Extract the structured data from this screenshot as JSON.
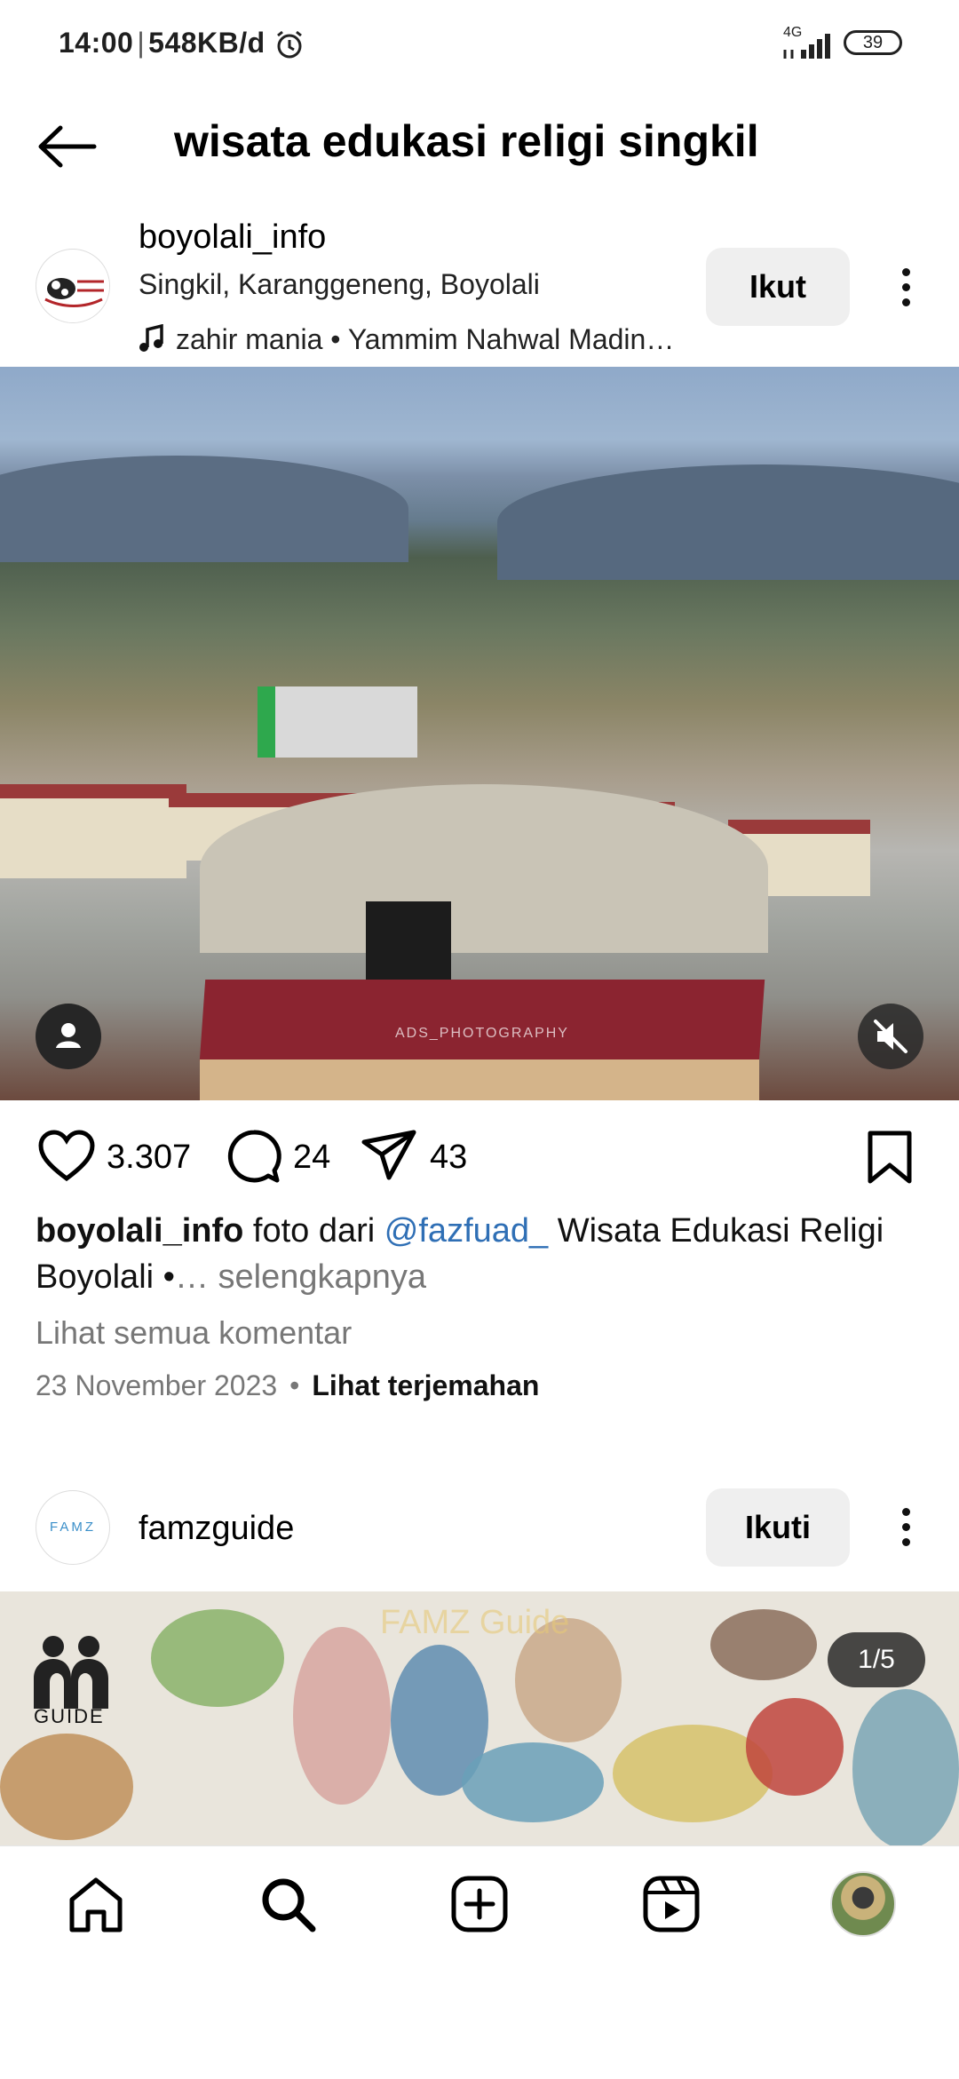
{
  "status": {
    "time": "14:00",
    "speed": "548KB/d",
    "network": "4G",
    "battery": "39"
  },
  "header": {
    "title": "wisata edukasi religi singkil"
  },
  "post1": {
    "username": "boyolali_info",
    "location": "Singkil, Karanggeneng, Boyolali",
    "music": "zahir mania • Yammim Nahwal Madin…",
    "follow_label": "Ikut",
    "avatar_text": "Boyolali Info",
    "watermark": "ADS_PHOTOGRAPHY",
    "likes": "3.307",
    "comments": "24",
    "shares": "43",
    "caption_user": "boyolali_info",
    "caption_text1": "foto dari",
    "caption_mention": "@fazfuad_",
    "caption_text2": "Wisata Edukasi Religi Boyolali •",
    "caption_more": "… selengkapnya",
    "all_comments": "Lihat semua komentar",
    "date": "23 November 2023",
    "translate": "Lihat terjemahan"
  },
  "post2": {
    "username": "famzguide",
    "avatar_text": "FAMZ",
    "follow_label": "Ikuti",
    "watermark": "FAMZ Guide",
    "logo_text": "GUIDE",
    "counter": "1/5"
  },
  "colors": {
    "accent_link": "#2f6fb5",
    "follow_bg": "#efefef"
  },
  "icons": [
    "back-arrow-icon",
    "more-icon",
    "music-note-icon",
    "heart-icon",
    "comment-icon",
    "share-icon",
    "bookmark-icon",
    "user-tag-icon",
    "mute-icon",
    "home-icon",
    "search-icon",
    "add-post-icon",
    "reels-icon",
    "profile-avatar"
  ]
}
